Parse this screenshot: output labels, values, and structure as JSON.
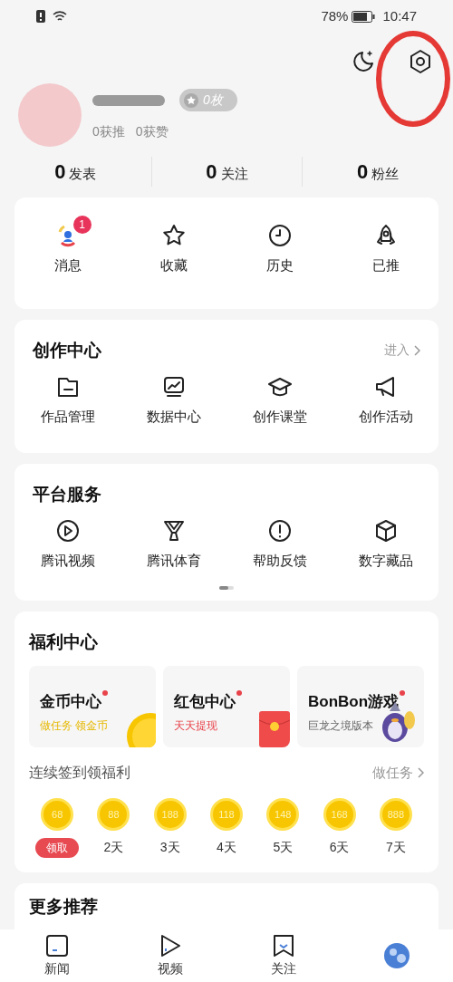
{
  "status_bar": {
    "battery": "78%",
    "time": "10:47"
  },
  "profile": {
    "badge": "0枚",
    "stats_small": [
      "0获推",
      "0获赞"
    ]
  },
  "stats": [
    {
      "value": "0",
      "label": "发表"
    },
    {
      "value": "0",
      "label": "关注"
    },
    {
      "value": "0",
      "label": "粉丝"
    }
  ],
  "quick_actions": [
    {
      "kind": "message",
      "label": "消息",
      "badge": "1"
    },
    {
      "kind": "star",
      "label": "收藏"
    },
    {
      "kind": "clock",
      "label": "历史"
    },
    {
      "kind": "rocket",
      "label": "已推"
    }
  ],
  "creation_center": {
    "title": "创作中心",
    "link": "进入",
    "items": [
      {
        "kind": "folder",
        "label": "作品管理"
      },
      {
        "kind": "chart",
        "label": "数据中心"
      },
      {
        "kind": "cap",
        "label": "创作课堂"
      },
      {
        "kind": "megaphone",
        "label": "创作活动"
      }
    ]
  },
  "platform_services": {
    "title": "平台服务",
    "items": [
      {
        "kind": "play",
        "label": "腾讯视频"
      },
      {
        "kind": "trophy",
        "label": "腾讯体育"
      },
      {
        "kind": "alert",
        "label": "帮助反馈"
      },
      {
        "kind": "cube",
        "label": "数字藏品"
      }
    ]
  },
  "welfare": {
    "title": "福利中心",
    "cards": [
      {
        "kind": "coin",
        "title": "金币中心",
        "subtitle": "做任务 领金币",
        "color": "#e6b800"
      },
      {
        "kind": "envelope",
        "title": "红包中心",
        "subtitle": "天天提现",
        "color": "#e8434b"
      },
      {
        "kind": "mascot",
        "title": "BonBon游戏",
        "subtitle": "巨龙之境版本",
        "color": "#666666"
      }
    ],
    "checkin_title": "连续签到领福利",
    "checkin_link": "做任务",
    "days": [
      {
        "coins": "68",
        "label": "领取",
        "kind": "claim"
      },
      {
        "coins": "88",
        "label": "2天",
        "kind": "day"
      },
      {
        "coins": "188",
        "label": "3天",
        "kind": "day"
      },
      {
        "coins": "118",
        "label": "4天",
        "kind": "day"
      },
      {
        "coins": "148",
        "label": "5天",
        "kind": "day"
      },
      {
        "coins": "168",
        "label": "6天",
        "kind": "day"
      },
      {
        "coins": "888",
        "label": "7天",
        "kind": "day"
      }
    ]
  },
  "more": {
    "title": "更多推荐"
  },
  "tab_bar": [
    {
      "kind": "news",
      "label": "新闻"
    },
    {
      "kind": "video",
      "label": "视频"
    },
    {
      "kind": "follow",
      "label": "关注"
    },
    {
      "kind": "me"
    }
  ]
}
